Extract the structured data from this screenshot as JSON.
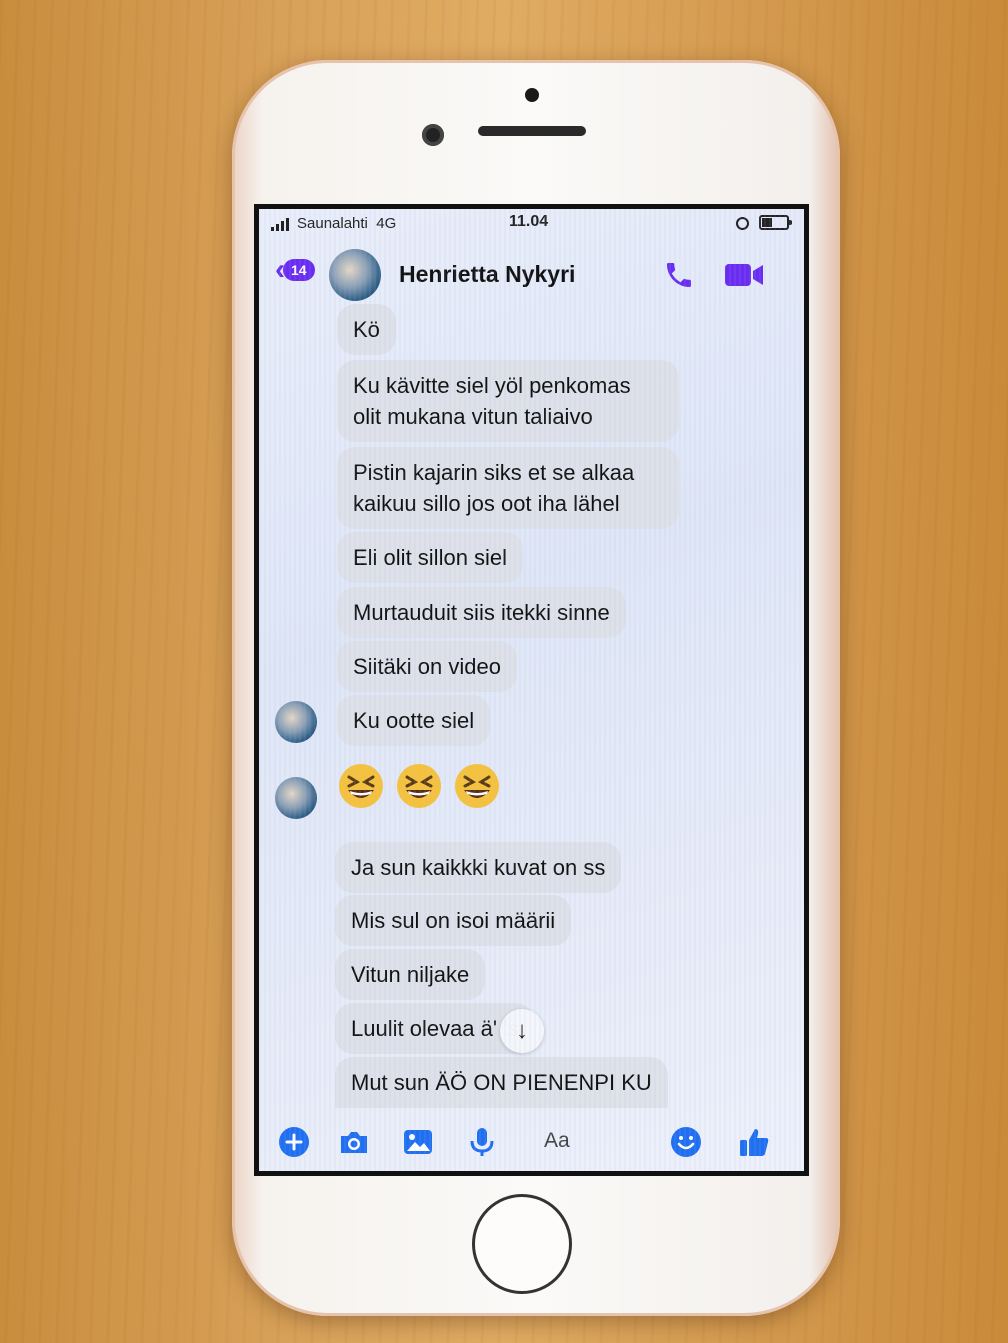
{
  "status_bar": {
    "carrier": "Saunalahti",
    "network": "4G",
    "time": "11.04"
  },
  "header": {
    "back_badge": "14",
    "contact_name": "Henrietta Nykyri"
  },
  "messages": [
    {
      "text": "Kö"
    },
    {
      "text": "Ku kävitte siel yöl penkomas olit mukana vitun taliaivo"
    },
    {
      "text": "Pistin kajarin siks et se alkaa kaikuu sillo jos oot iha lähel"
    },
    {
      "text": "Eli olit sillon siel"
    },
    {
      "text": "Murtauduit siis itekki sinne"
    },
    {
      "text": "Siitäki on video"
    },
    {
      "text": "Ku ootte siel"
    },
    {
      "emoji": [
        "grinning-squinting-face",
        "grinning-squinting-face",
        "grinning-squinting-face"
      ]
    },
    {
      "text": "Ja sun kaikkki kuvat on ss"
    },
    {
      "text": "Mis sul on isoi määrii"
    },
    {
      "text": "Vitun niljake"
    },
    {
      "text": "Luulit olevaa ä'  's"
    },
    {
      "text": "Mut sun ÄÖ ON PIENENPI KU"
    }
  ],
  "composer": {
    "placeholder": "Aa"
  },
  "colors": {
    "accent": "#6a2cf0",
    "messenger_blue": "#1f6ff0",
    "bubble": "#dee0e8"
  }
}
